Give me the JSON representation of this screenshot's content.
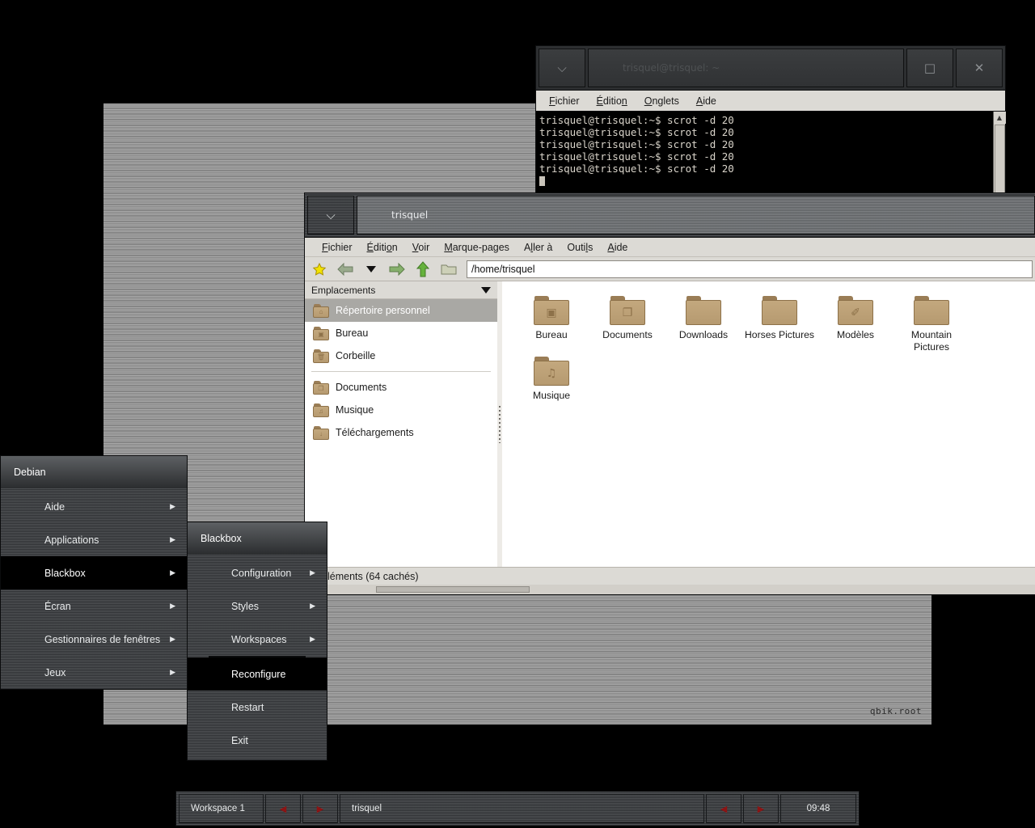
{
  "desktop": {
    "wallpaper_watermark": "qbik.root",
    "wallpaper_color": "#9a9a9a",
    "background_color": "#000000"
  },
  "terminal_window": {
    "title": "trisquel@trisquel: ~",
    "focused": false,
    "iconify_icon": "iconify-icon",
    "maximize_icon": "maximize-icon",
    "close_icon": "close-icon",
    "menu": [
      "Fichier",
      "Édition",
      "Onglets",
      "Aide"
    ],
    "lines": [
      "trisquel@trisquel:~$ scrot -d 20",
      "trisquel@trisquel:~$ scrot -d 20",
      "trisquel@trisquel:~$ scrot -d 20",
      "trisquel@trisquel:~$ scrot -d 20",
      "trisquel@trisquel:~$ scrot -d 20"
    ],
    "scrollbar_up_icon": "scroll-up-icon"
  },
  "file_manager": {
    "title": "trisquel",
    "focused": true,
    "menu": [
      "Fichier",
      "Édition",
      "Voir",
      "Marque-pages",
      "Aller à",
      "Outils",
      "Aide"
    ],
    "toolbar_icons": [
      "bookmark-star-icon",
      "back-icon",
      "history-dropdown-icon",
      "forward-icon",
      "up-icon",
      "open-folder-icon"
    ],
    "path_value": "/home/trisquel",
    "sidebar": {
      "header": "Emplacements",
      "header_dropdown_icon": "chevron-down-icon",
      "items": [
        {
          "label": "Répertoire personnel",
          "icon": "home-folder-icon",
          "selected": true,
          "glyph": "⌂"
        },
        {
          "label": "Bureau",
          "icon": "desktop-folder-icon",
          "selected": false,
          "glyph": "▣"
        },
        {
          "label": "Corbeille",
          "icon": "trash-icon",
          "selected": false,
          "glyph": "🗑"
        },
        {
          "label": "Documents",
          "icon": "documents-folder-icon",
          "selected": false,
          "glyph": "❐"
        },
        {
          "label": "Musique",
          "icon": "music-folder-icon",
          "selected": false,
          "glyph": "♫"
        },
        {
          "label": "Téléchargements",
          "icon": "downloads-folder-icon",
          "selected": false,
          "glyph": "↓"
        }
      ],
      "separator_after_index": 2
    },
    "files": [
      {
        "name": "Bureau",
        "icon": "desktop-folder-icon",
        "glyph": "▣"
      },
      {
        "name": "Documents",
        "icon": "documents-folder-icon",
        "glyph": "❐"
      },
      {
        "name": "Downloads",
        "icon": "folder-icon",
        "glyph": ""
      },
      {
        "name": "Horses Pictures",
        "icon": "folder-icon",
        "glyph": ""
      },
      {
        "name": "Modèles",
        "icon": "templates-folder-icon",
        "glyph": "✐"
      },
      {
        "name": "Mountain Pictures",
        "icon": "folder-icon",
        "glyph": ""
      },
      {
        "name": "Musique",
        "icon": "music-folder-icon",
        "glyph": "♫"
      }
    ],
    "status_text": "léments (64 cachés)"
  },
  "root_menu": {
    "title": "Debian",
    "items": [
      {
        "label": "Aide",
        "submenu": true,
        "highlighted": false
      },
      {
        "label": "Applications",
        "submenu": true,
        "highlighted": false
      },
      {
        "label": "Blackbox",
        "submenu": true,
        "highlighted": true
      },
      {
        "label": "Écran",
        "submenu": true,
        "highlighted": false
      },
      {
        "label": "Gestionnaires de fenêtres",
        "submenu": true,
        "highlighted": false
      },
      {
        "label": "Jeux",
        "submenu": true,
        "highlighted": false
      }
    ]
  },
  "blackbox_menu": {
    "title": "Blackbox",
    "items": [
      {
        "label": "Configuration",
        "submenu": true,
        "highlighted": false,
        "separator_after": false
      },
      {
        "label": "Styles",
        "submenu": true,
        "highlighted": false,
        "separator_after": false
      },
      {
        "label": "Workspaces",
        "submenu": true,
        "highlighted": false,
        "separator_after": true
      },
      {
        "label": "Reconfigure",
        "submenu": false,
        "highlighted": true,
        "separator_after": false
      },
      {
        "label": "Restart",
        "submenu": false,
        "highlighted": false,
        "separator_after": false
      },
      {
        "label": "Exit",
        "submenu": false,
        "highlighted": false,
        "separator_after": false
      }
    ]
  },
  "toolbar": {
    "workspace_label": "Workspace 1",
    "prev_workspace_icon": "◀",
    "next_workspace_icon": "▶",
    "task_label": "trisquel",
    "prev_window_icon": "◀",
    "next_window_icon": "▶",
    "clock": "09:48",
    "arrow_color": "#8b1414"
  }
}
